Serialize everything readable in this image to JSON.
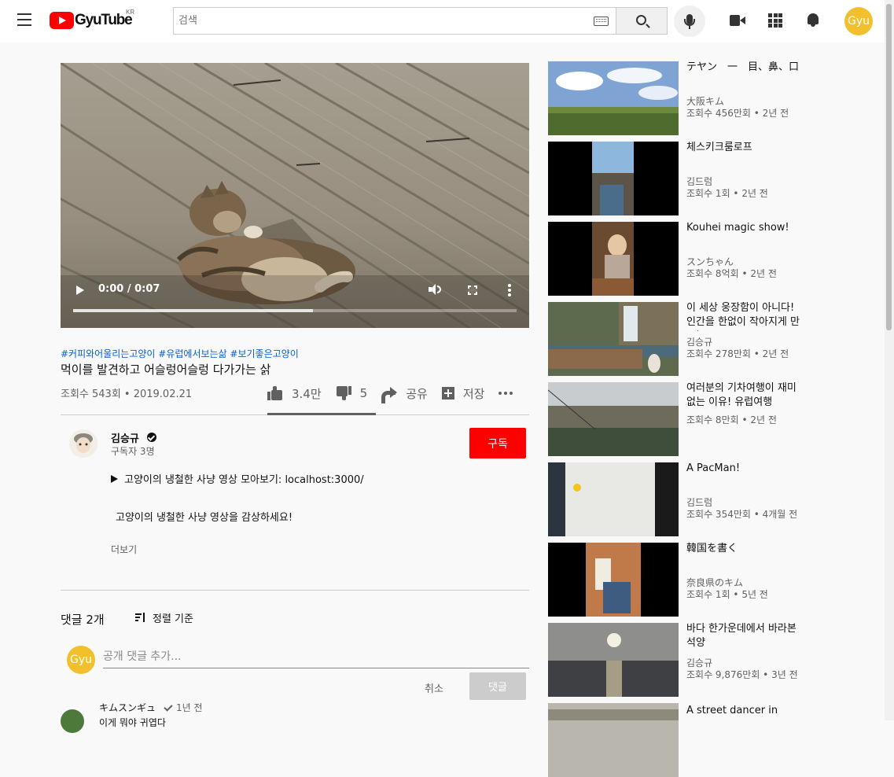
{
  "header": {
    "logo_text": "GyuTube",
    "region": "KR",
    "search_placeholder": "검색",
    "user_initials": "Gyu"
  },
  "player": {
    "time": "0:00 / 0:07",
    "progress": 0.54
  },
  "video": {
    "tags": "#커피와어울리는고양이 #유럽에서보는삶 #보기좋은고양이",
    "title": "먹이를 발견하고 어슬렁어슬렁 다가가는 삵",
    "views_date": "조회수 543회 • 2019.02.21",
    "likes": "3.4만",
    "dislikes": "5",
    "share_label": "공유",
    "save_label": "저장"
  },
  "channel": {
    "name": "김승규",
    "subscribers": "구독자 3명",
    "subscribe_label": "구독"
  },
  "description": {
    "line1": "고양이의 냉철한 사냥 영상 모아보기: localhost:3000/",
    "line2": "고양이의 냉철한 사냥 영상을 감상하세요!",
    "more_label": "더보기"
  },
  "comments": {
    "count_label": "댓글 2개",
    "sort_label": "정렬 기준",
    "input_placeholder": "공개 댓글 추가...",
    "user_initials": "Gyu",
    "cancel_label": "취소",
    "submit_label": "댓글",
    "first": {
      "author": "キムスンギュ",
      "time": "1년 전",
      "text": "이게 뭐야 귀엽다"
    }
  },
  "sidebar": {
    "items": [
      {
        "title": "テヤン　一　目、鼻、口",
        "channel": "大阪キム",
        "meta": "조회수 456만회 • 2년 전"
      },
      {
        "title": "체스키크룸로프",
        "channel": "김드럼",
        "meta": "조회수 1회 • 2년 전"
      },
      {
        "title": "Kouhei magic show!",
        "channel": "スンちゃん",
        "meta": "조회수 8억회 • 2년 전"
      },
      {
        "title": "이 세상 웅장함이 아니다! 인간을 한없이 작아지게 만드는",
        "channel": "김승규",
        "meta": "조회수 278만회 • 2년 전"
      },
      {
        "title": "여러분의 기차여행이 재미없는 이유! 유럽여행",
        "channel": "",
        "meta": "조회수 8만회 • 2년 전"
      },
      {
        "title": "A PacMan!",
        "channel": "김드럼",
        "meta": "조회수 354만회 • 4개월 전"
      },
      {
        "title": "韓国を書く",
        "channel": "奈良県のキム",
        "meta": "조회수 1회 • 5년 전"
      },
      {
        "title": "바다 한가운데에서 바라본 석양",
        "channel": "김승규",
        "meta": "조회수 9,876만회 • 3년 전"
      },
      {
        "title": "A street dancer in",
        "channel": "",
        "meta": ""
      }
    ]
  }
}
